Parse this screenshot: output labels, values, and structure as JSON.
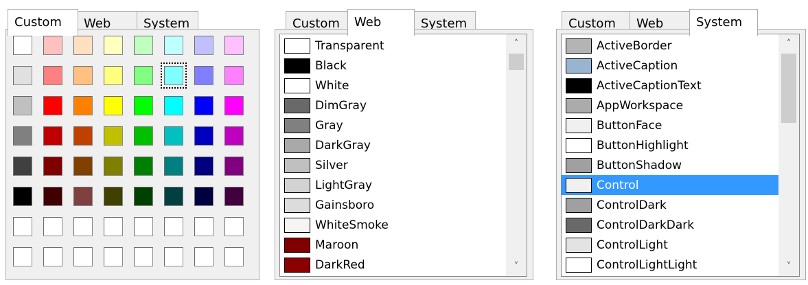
{
  "colors": {
    "tab_border": "#adadad",
    "selection": "#3399ff",
    "panel_bg": "#f0f0f0",
    "scroll_thumb": "#cdcdcd"
  },
  "custom_panel": {
    "tabs": [
      {
        "label": "Custom",
        "active": true
      },
      {
        "label": "Web",
        "active": false
      },
      {
        "label": "System",
        "active": false
      }
    ],
    "swatches": [
      [
        "#ffffff",
        "#ffc0c0",
        "#ffe0c0",
        "#ffffc0",
        "#c0ffc0",
        "#c0ffff",
        "#c0c0ff",
        "#ffc0ff"
      ],
      [
        "#e0e0e0",
        "#ff8080",
        "#ffc080",
        "#ffff80",
        "#80ff80",
        "#80ffff",
        "#8080ff",
        "#ff80ff"
      ],
      [
        "#c0c0c0",
        "#ff0000",
        "#ff8000",
        "#ffff00",
        "#00ff00",
        "#00ffff",
        "#0000ff",
        "#ff00ff"
      ],
      [
        "#808080",
        "#c00000",
        "#c04000",
        "#c0c000",
        "#00c000",
        "#00c0c0",
        "#0000c0",
        "#c000c0"
      ],
      [
        "#404040",
        "#800000",
        "#804000",
        "#808000",
        "#008000",
        "#008080",
        "#000080",
        "#800080"
      ],
      [
        "#000000",
        "#400000",
        "#804040",
        "#404000",
        "#004000",
        "#004040",
        "#000040",
        "#400040"
      ],
      [
        "#ffffff",
        "#ffffff",
        "#ffffff",
        "#ffffff",
        "#ffffff",
        "#ffffff",
        "#ffffff",
        "#ffffff"
      ],
      [
        "#ffffff",
        "#ffffff",
        "#ffffff",
        "#ffffff",
        "#ffffff",
        "#ffffff",
        "#ffffff",
        "#ffffff"
      ]
    ],
    "selected": {
      "row": 1,
      "col": 5
    }
  },
  "web_panel": {
    "tabs": [
      {
        "label": "Custom",
        "active": false
      },
      {
        "label": "Web",
        "active": true
      },
      {
        "label": "System",
        "active": false
      }
    ],
    "items": [
      {
        "label": "Transparent",
        "color": "#ffffff"
      },
      {
        "label": "Black",
        "color": "#000000"
      },
      {
        "label": "White",
        "color": "#ffffff"
      },
      {
        "label": "DimGray",
        "color": "#696969"
      },
      {
        "label": "Gray",
        "color": "#808080"
      },
      {
        "label": "DarkGray",
        "color": "#a9a9a9"
      },
      {
        "label": "Silver",
        "color": "#c0c0c0"
      },
      {
        "label": "LightGray",
        "color": "#d3d3d3"
      },
      {
        "label": "Gainsboro",
        "color": "#dcdcdc"
      },
      {
        "label": "WhiteSmoke",
        "color": "#f5f5f5"
      },
      {
        "label": "Maroon",
        "color": "#800000"
      },
      {
        "label": "DarkRed",
        "color": "#8b0000"
      }
    ],
    "scroll_position": 0.0,
    "scroll_visible_fraction": 0.08
  },
  "system_panel": {
    "tabs": [
      {
        "label": "Custom",
        "active": false
      },
      {
        "label": "Web",
        "active": false
      },
      {
        "label": "System",
        "active": true
      }
    ],
    "items": [
      {
        "label": "ActiveBorder",
        "color": "#b4b4b4"
      },
      {
        "label": "ActiveCaption",
        "color": "#99b4d1"
      },
      {
        "label": "ActiveCaptionText",
        "color": "#000000"
      },
      {
        "label": "AppWorkspace",
        "color": "#ababab"
      },
      {
        "label": "ButtonFace",
        "color": "#f0f0f0"
      },
      {
        "label": "ButtonHighlight",
        "color": "#ffffff"
      },
      {
        "label": "ButtonShadow",
        "color": "#a0a0a0"
      },
      {
        "label": "Control",
        "color": "#f0f0f0",
        "selected": true
      },
      {
        "label": "ControlDark",
        "color": "#a0a0a0"
      },
      {
        "label": "ControlDarkDark",
        "color": "#696969"
      },
      {
        "label": "ControlLight",
        "color": "#e3e3e3"
      },
      {
        "label": "ControlLightLight",
        "color": "#ffffff"
      }
    ],
    "scroll_position": 0.0,
    "scroll_visible_fraction": 0.34
  },
  "scroll_arrows": {
    "up": "˄",
    "down": "˅"
  }
}
